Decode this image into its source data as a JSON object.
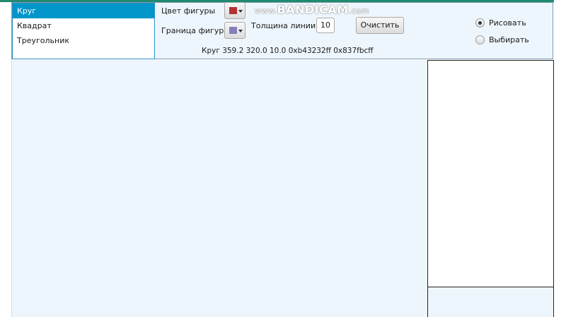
{
  "shape_list": {
    "items": [
      {
        "label": "Круг",
        "selected": true
      },
      {
        "label": "Квадрат",
        "selected": false
      },
      {
        "label": "Треугольник",
        "selected": false
      }
    ]
  },
  "controls": {
    "fill_color_label": "Цвет фигуры",
    "fill_color_value": "#b43232",
    "border_color_label": "Граница фигуры",
    "border_color_value": "#837fbc",
    "line_width_label": "Толщина линии",
    "line_width_value": "10",
    "clear_label": "Очистить"
  },
  "status": {
    "text": "Круг 359.2 320.0 10.0 0xb43232ff 0x837fbcff"
  },
  "mode": {
    "draw_label": "Рисовать",
    "select_label": "Выбирать",
    "selected": "draw"
  },
  "watermark": {
    "prefix": "www.",
    "brand": "BANDICAM",
    "suffix": ".com"
  }
}
